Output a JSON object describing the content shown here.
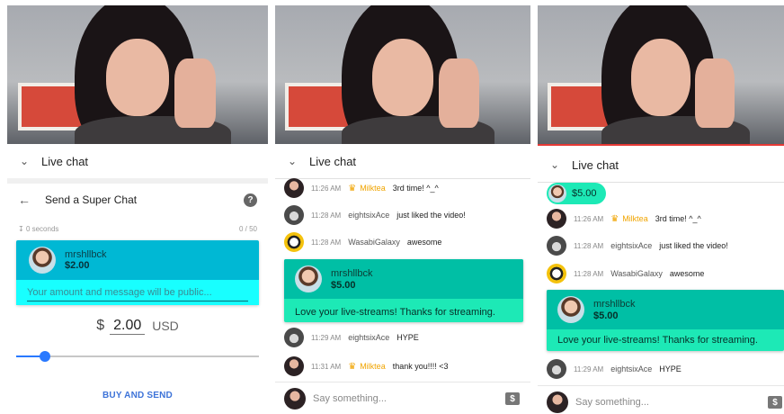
{
  "panel1": {
    "chat_header": "Live chat",
    "super_chat_title": "Send a Super Chat",
    "help_icon": "?",
    "timer_label": "0 seconds",
    "char_count": "0 / 50",
    "card_name": "mrshllbck",
    "card_amount": "$2.00",
    "message_placeholder": "Your amount and message will be public...",
    "currency_symbol": "$",
    "amount_value": "2.00",
    "currency_code": "USD",
    "slider_value": 0.12,
    "buy_button": "BUY AND SEND"
  },
  "panel2": {
    "chat_header": "Live chat",
    "messages": [
      {
        "time": "11:26 AM",
        "name": "Milktea",
        "text": "3rd time! ^_^",
        "crown": true
      },
      {
        "time": "11:28 AM",
        "name": "eightsixAce",
        "text": "just liked the video!",
        "crown": false
      },
      {
        "time": "11:28 AM",
        "name": "WasabiGalaxy",
        "text": "awesome",
        "crown": false
      },
      {
        "time": "11:29 AM",
        "name": "eightsixAce",
        "text": "HYPE",
        "crown": false
      },
      {
        "time": "11:31 AM",
        "name": "Milktea",
        "text": "thank you!!!! <3",
        "crown": true
      }
    ],
    "super_chat": {
      "name": "mrshllbck",
      "amount": "$5.00",
      "message": "Love your live-streams! Thanks for streaming."
    },
    "input_placeholder": "Say something...",
    "dollar_icon": "$"
  },
  "panel3": {
    "chat_header": "Live chat",
    "pinned_amount": "$5.00",
    "messages": [
      {
        "time": "11:26 AM",
        "name": "Milktea",
        "text": "3rd time! ^_^",
        "crown": true
      },
      {
        "time": "11:28 AM",
        "name": "eightsixAce",
        "text": "just liked the video!",
        "crown": false
      },
      {
        "time": "11:28 AM",
        "name": "WasabiGalaxy",
        "text": "awesome",
        "crown": false
      },
      {
        "time": "11:29 AM",
        "name": "eightsixAce",
        "text": "HYPE",
        "crown": false
      }
    ],
    "super_chat": {
      "name": "mrshllbck",
      "amount": "$5.00",
      "message": "Love your live-streams! Thanks for streaming."
    },
    "input_placeholder": "Say something...",
    "dollar_icon": "$"
  },
  "colors": {
    "accent_red": "#e53935",
    "super_chat_green": "#1de9b6",
    "super_chat_blue": "#00b8d4",
    "crown_gold": "#f0a400",
    "link_blue": "#3d73d8"
  }
}
